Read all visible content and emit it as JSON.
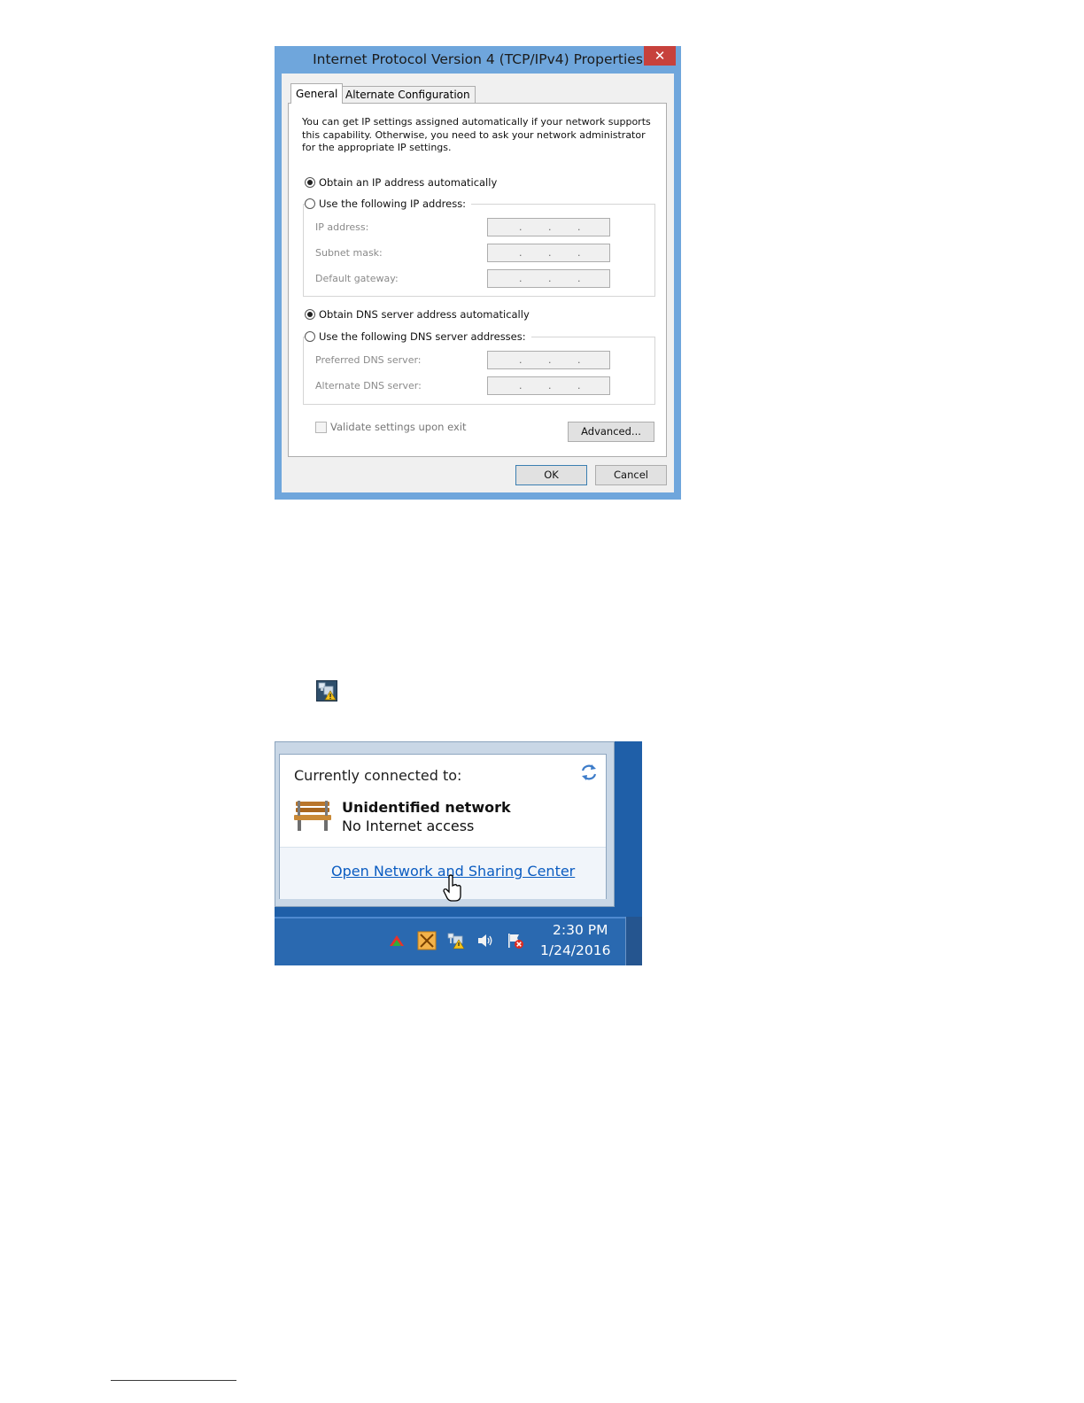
{
  "dialog": {
    "title": "Internet Protocol Version 4 (TCP/IPv4) Properties",
    "close_glyph": "✕",
    "tabs": [
      "General",
      "Alternate Configuration"
    ],
    "intro": "You can get IP settings assigned automatically if your network supports this capability. Otherwise, you need to ask your network administrator for the appropriate IP settings.",
    "ip_auto_label": "Obtain an IP address automatically",
    "ip_manual_label": "Use the following IP address:",
    "ip_fields": [
      "IP address:",
      "Subnet mask:",
      "Default gateway:"
    ],
    "dns_auto_label": "Obtain DNS server address automatically",
    "dns_manual_label": "Use the following DNS server addresses:",
    "dns_fields": [
      "Preferred DNS server:",
      "Alternate DNS server:"
    ],
    "validate_label": "Validate settings upon exit",
    "advanced_button": "Advanced...",
    "ok_button": "OK",
    "cancel_button": "Cancel",
    "ip_dot": "."
  },
  "popup": {
    "title": "Currently connected to:",
    "network_name": "Unidentified network",
    "network_status": "No Internet access",
    "link": "Open Network and Sharing Center"
  },
  "taskbar": {
    "time": "2:30 PM",
    "date": "1/24/2016",
    "icons": [
      "arrow-up-icon",
      "app-x-icon",
      "network-warning-icon",
      "speaker-icon",
      "action-center-flag-icon"
    ]
  }
}
